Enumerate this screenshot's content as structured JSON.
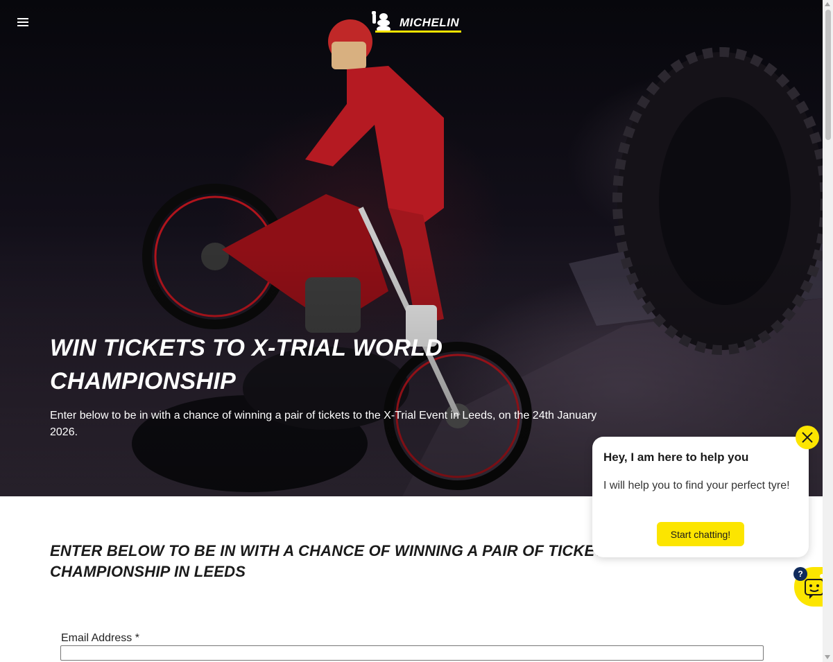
{
  "header": {
    "brand": "MICHELIN",
    "menu_icon": "hamburger-menu-icon"
  },
  "hero": {
    "title": "WIN TICKETS TO X-TRIAL WORLD CHAMPIONSHIP",
    "description": "Enter below to be in with a chance of winning a pair of tickets to the X-Trial Event in Leeds, on the 24th January 2026."
  },
  "form": {
    "heading": "ENTER BELOW TO BE IN WITH A CHANCE OF WINNING A PAIR OF TICKETS TO THE X-TRIAL CHAMPIONSHIP IN LEEDS",
    "email_label": "Email Address *",
    "email_value": ""
  },
  "chat": {
    "title": "Hey, I am here to help you",
    "message": "I will help you to find your perfect tyre!",
    "cta_label": "Start chatting!",
    "badge": "?",
    "close_icon": "close-icon",
    "launcher_icon": "chatbot-icon"
  },
  "colors": {
    "brand_yellow": "#fce500",
    "badge_navy": "#102b5c",
    "text_dark": "#1a1a1a"
  }
}
